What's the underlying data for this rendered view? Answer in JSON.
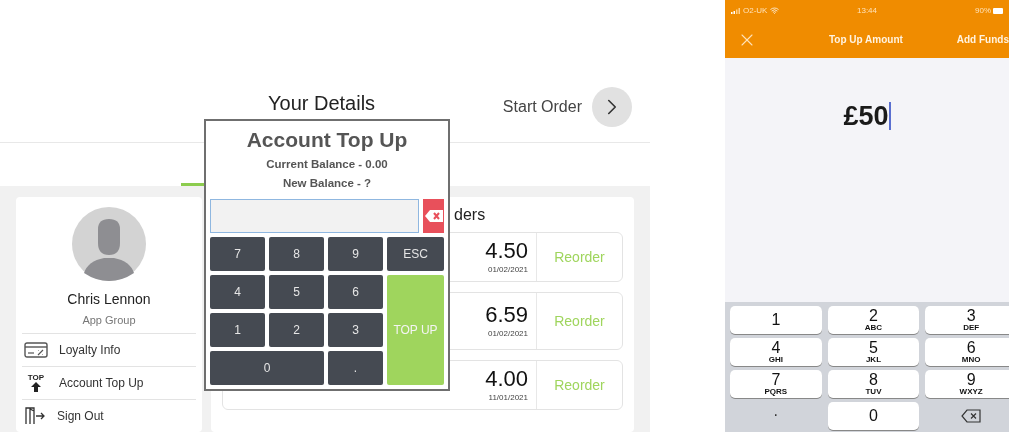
{
  "web_app": {
    "heading": "Your Details",
    "start_order": {
      "label": "Start Order"
    },
    "tabs": [
      {
        "selected": true
      }
    ],
    "profile": {
      "name": "Chris Lennon",
      "group": "App Group",
      "menu": [
        {
          "kind": "card",
          "label": "Loyalty Info"
        },
        {
          "kind": "top",
          "icon_label": "TOP",
          "label": "Account Top Up"
        },
        {
          "kind": "door",
          "label": "Sign Out"
        }
      ]
    },
    "orders": {
      "title": "ders",
      "rows": [
        {
          "price": "4.50",
          "date": "01/02/2021",
          "action": "Reorder"
        },
        {
          "price": "6.59",
          "date": "01/02/2021",
          "action": "Reorder"
        },
        {
          "price": "4.00",
          "date": "11/01/2021",
          "action": "Reorder"
        }
      ]
    },
    "top_up_dialog": {
      "title": "Account Top Up",
      "current_balance": "Current Balance - 0.00",
      "new_balance": "New Balance - ?",
      "keys": [
        {
          "kind": "digit",
          "label": "7"
        },
        {
          "kind": "digit",
          "label": "8"
        },
        {
          "kind": "digit",
          "label": "9"
        },
        {
          "kind": "digit",
          "label": "4"
        },
        {
          "kind": "digit",
          "label": "5"
        },
        {
          "kind": "digit",
          "label": "6"
        },
        {
          "kind": "digit",
          "label": "1"
        },
        {
          "kind": "digit",
          "label": "2"
        },
        {
          "kind": "digit",
          "label": "3"
        },
        {
          "kind": "wide",
          "label": "0"
        },
        {
          "kind": "digit",
          "label": "."
        }
      ],
      "side_keys": [
        {
          "kind": "esc",
          "label": "ESC"
        },
        {
          "kind": "submit",
          "label": "TOP UP"
        }
      ]
    }
  },
  "phone": {
    "status_bar": {
      "carrier": "O2-UK",
      "time": "13:44",
      "battery": "90%"
    },
    "nav": {
      "title": "Top Up Amount",
      "action": "Add Funds"
    },
    "amount": {
      "value": "£50",
      "focused": true
    },
    "keypad_rows": [
      {
        "keys": [
          {
            "kind": "key",
            "digit": "1"
          },
          {
            "kind": "key",
            "digit": "2",
            "letters": "ABC"
          },
          {
            "kind": "key",
            "digit": "3",
            "letters": "DEF"
          }
        ]
      },
      {
        "keys": [
          {
            "kind": "key",
            "digit": "4",
            "letters": "GHI"
          },
          {
            "kind": "key",
            "digit": "5",
            "letters": "JKL"
          },
          {
            "kind": "key",
            "digit": "6",
            "letters": "MNO"
          }
        ]
      },
      {
        "keys": [
          {
            "kind": "key",
            "digit": "7",
            "letters": "PQRS"
          },
          {
            "kind": "key",
            "digit": "8",
            "letters": "TUV"
          },
          {
            "kind": "key",
            "digit": "9",
            "letters": "WXYZ"
          }
        ]
      },
      {
        "keys": [
          {
            "kind": "plain",
            "digit": "."
          },
          {
            "kind": "key",
            "digit": "0"
          },
          {
            "kind": "delete"
          }
        ]
      }
    ]
  }
}
